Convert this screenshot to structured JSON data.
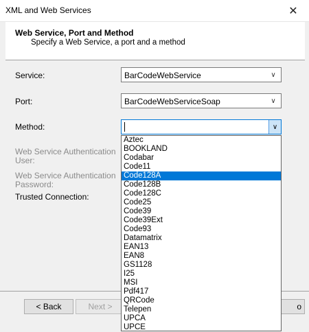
{
  "window": {
    "title": "XML and Web Services"
  },
  "header": {
    "title": "Web Service, Port and Method",
    "subtitle": "Specify a Web Service, a port and a method"
  },
  "form": {
    "service_label": "Service:",
    "service_value": "BarCodeWebService",
    "port_label": "Port:",
    "port_value": "BarCodeWebServiceSoap",
    "method_label": "Method:",
    "method_value": "",
    "auth_user_label_1": "Web Service Authentication",
    "auth_user_label_2": "User:",
    "auth_pass_label_1": "Web Service Authentication",
    "auth_pass_label_2": "Password:",
    "trusted_label": "Trusted Connection:"
  },
  "method_options": [
    "Aztec",
    "BOOKLAND",
    "Codabar",
    "Code11",
    "Code128A",
    "Code128B",
    "Code128C",
    "Code25",
    "Code39",
    "Code39Ext",
    "Code93",
    "Datamatrix",
    "EAN13",
    "EAN8",
    "GS1128",
    "I25",
    "MSI",
    "Pdf417",
    "QRCode",
    "Telepen",
    "UPCA",
    "UPCE"
  ],
  "selected_method": "Code128A",
  "footer": {
    "back_label": "< Back",
    "next_label": "Next >",
    "partial_right_label": "o"
  }
}
